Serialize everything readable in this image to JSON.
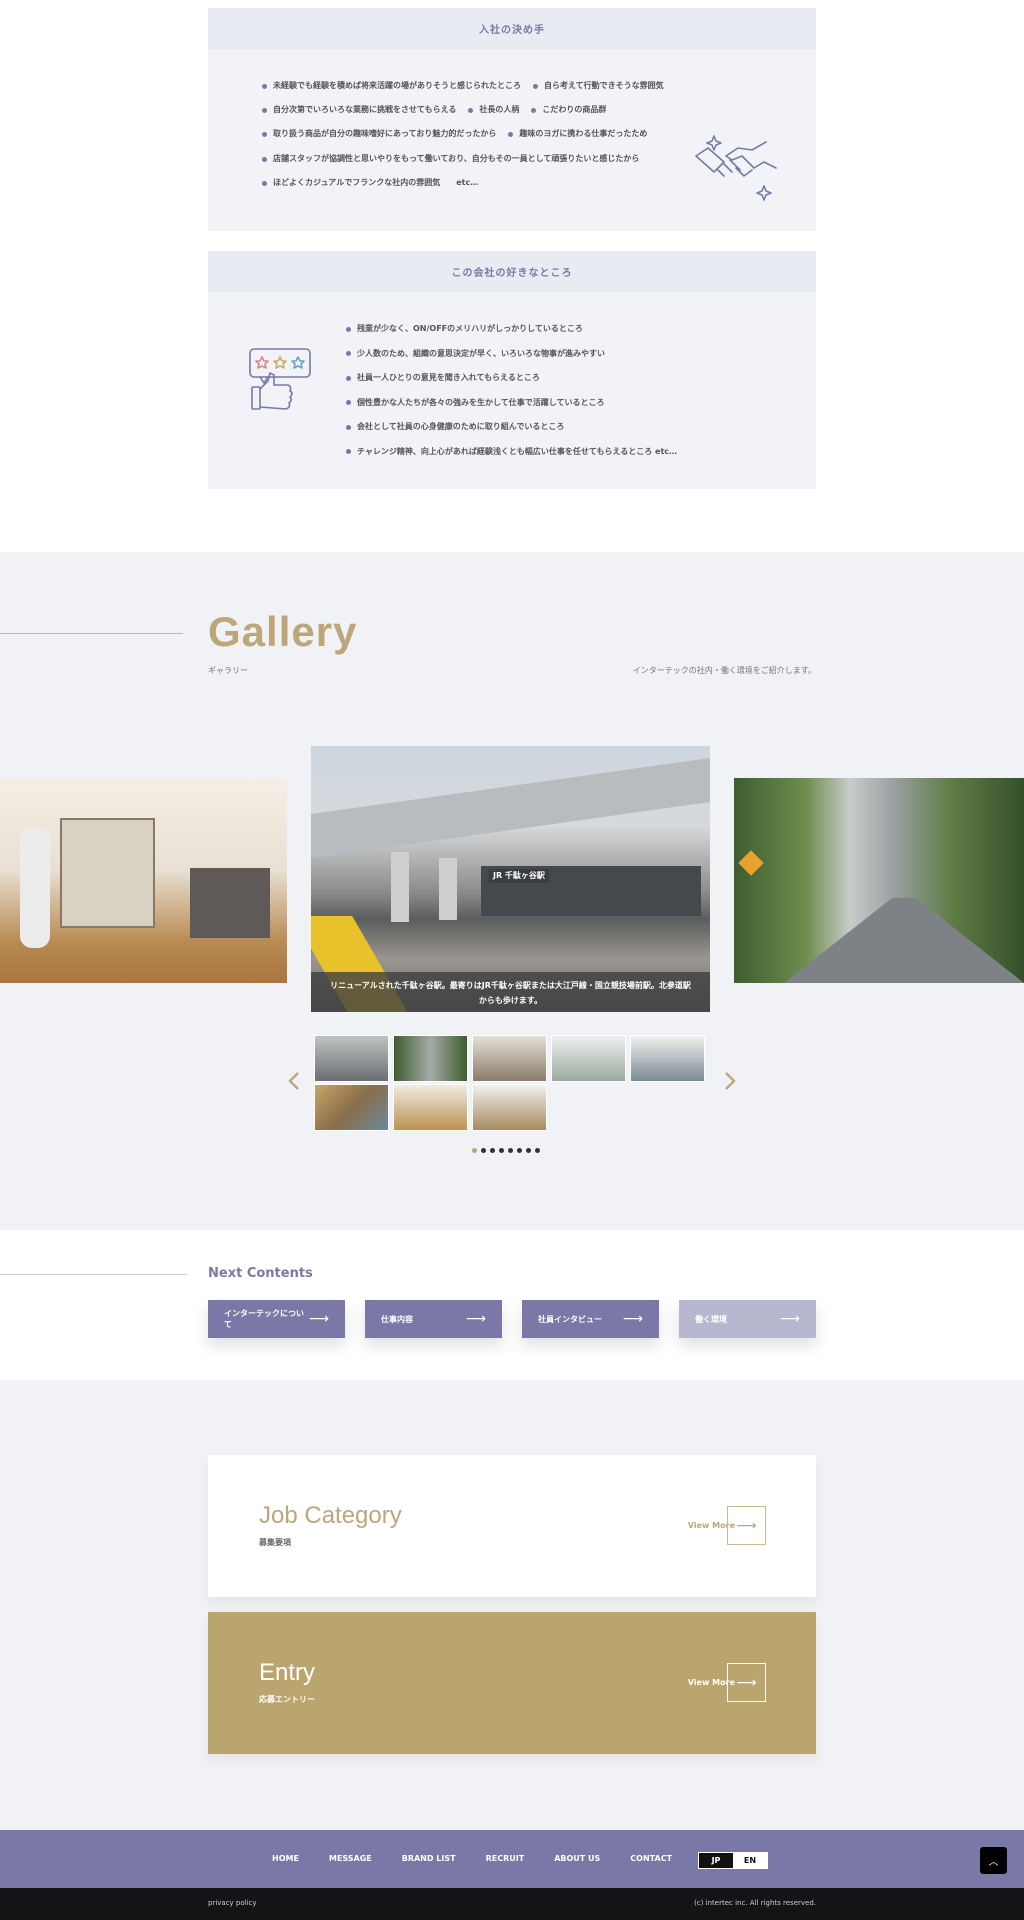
{
  "reasons": {
    "title": "入社の決め手",
    "rows": [
      [
        "未経験でも経験を積めば将来活躍の場がありそうと感じられたところ",
        "自ら考えて行動できそうな雰囲気"
      ],
      [
        "自分次第でいろいろな業務に挑戦をさせてもらえる",
        "社長の人柄",
        "こだわりの商品群"
      ],
      [
        "取り扱う商品が自分の趣味嗜好にあっており魅力的だったから",
        "趣味のヨガに携わる仕事だったため"
      ],
      [
        "店舗スタッフが協調性と思いやりをもって働いており、自分もその一員として頑張りたいと感じたから"
      ],
      [
        "ほどよくカジュアルでフランクな社内の雰囲気　　etc…"
      ]
    ],
    "icon": "handshake-icon"
  },
  "likes": {
    "title": "この会社の好きなところ",
    "items": [
      "残業が少なく、ON/OFFのメリハリがしっかりしているところ",
      "少人数のため、組織の意思決定が早く、いろいろな物事が進みやすい",
      "社員一人ひとりの意見を聞き入れてもらえるところ",
      "個性豊かな人たちが各々の強みを生かして仕事で活躍しているところ",
      "会社として社員の心身健康のために取り組んでいるところ",
      "チャレンジ精神、向上心があれば経験浅くとも幅広い仕事を任せてもらえるところ etc…"
    ],
    "icon": "thumbs-up-stars-icon"
  },
  "gallery": {
    "title": "Gallery",
    "subtitle": "ギャラリー",
    "description": "インターテックの社内・働く環境をご紹介します。",
    "caption": "リニューアルされた千駄ヶ谷駅。最寄りはJR千駄ヶ谷駅または大江戸線・国立競技場前駅。北参道駅からも歩けます。",
    "station_sign": "JR 千駄ヶ谷駅",
    "prev_icon": "chevron-left-icon",
    "next_icon": "chevron-right-icon"
  },
  "next_contents": {
    "title": "Next Contents",
    "buttons": [
      "インターテックについて",
      "仕事内容",
      "社員インタビュー",
      "働く環境"
    ]
  },
  "job": {
    "title": "Job Category",
    "subtitle": "募集要項",
    "link": "View More"
  },
  "entry": {
    "title": "Entry",
    "subtitle": "応募エントリー",
    "link": "View More"
  },
  "footer": {
    "nav": [
      "HOME",
      "MESSAGE",
      "BRAND LIST",
      "RECRUIT",
      "ABOUT US",
      "CONTACT"
    ],
    "lang_active": "JP",
    "lang_other": "EN",
    "privacy": "privacy policy",
    "copyright": "(c) intertec inc. All rights reserved."
  },
  "colors": {
    "purple": "#7a78a6",
    "gold": "#bda77a",
    "panel": "#f2f3f7"
  }
}
